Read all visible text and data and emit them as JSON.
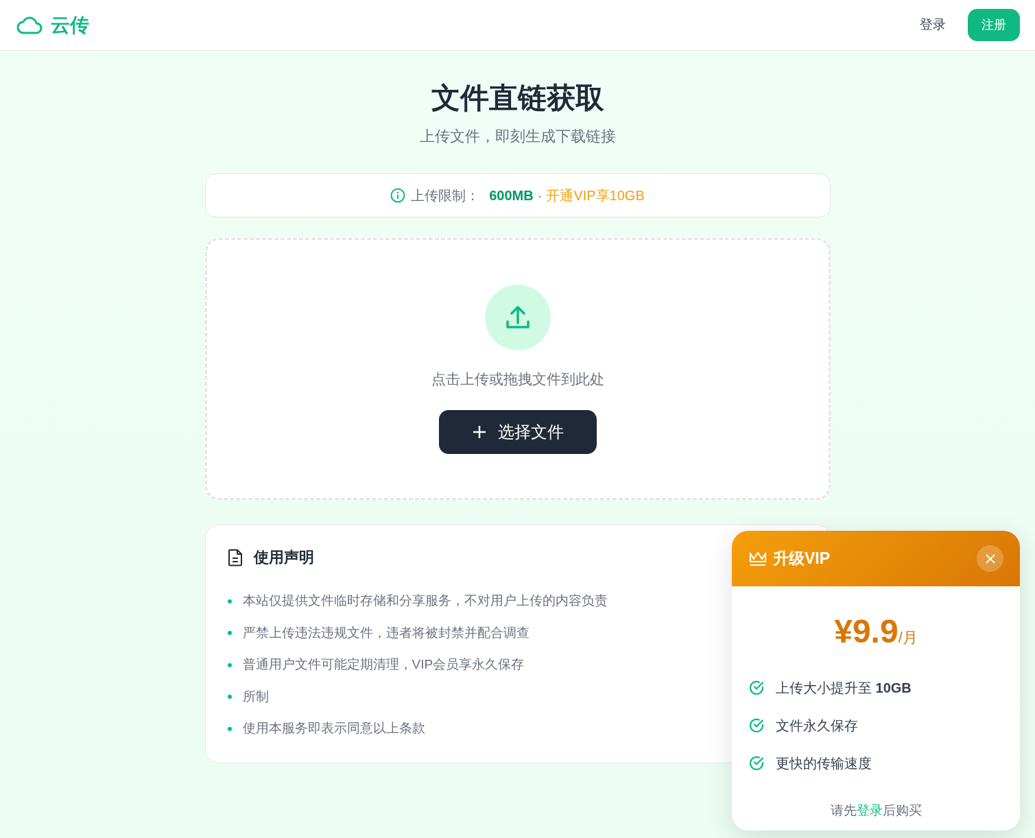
{
  "navbar": {
    "logo": "云传",
    "login": "登录",
    "register": "注册"
  },
  "hero": {
    "title": "文件直链获取",
    "subtitle": "上传文件，即刻生成下载链接"
  },
  "limit": {
    "label": "上传限制：",
    "size": "600MB",
    "separator": "·",
    "vip_offer": "开通VIP享10GB"
  },
  "dropzone": {
    "hint": "点击上传或拖拽文件到此处",
    "button": "选择文件"
  },
  "notice": {
    "title": "使用声明",
    "items": [
      "本站仅提供文件临时存储和分享服务，不对用户上传的内容负责",
      "严禁上传违法违规文件，违者将被封禁并配合调查",
      "普通用户文件可能定期清理，VIP会员享永久保存",
      "所制",
      "使用本服务即表示同意以上条款"
    ]
  },
  "vip_popup": {
    "title": "升级VIP",
    "price": "¥9.9",
    "unit": "/月",
    "features": [
      "上传大小提升至 **10GB**",
      "文件永久保存",
      "更快的传输速度"
    ],
    "note_before": "请先",
    "note_link": "登录",
    "note_after": "后购买"
  }
}
